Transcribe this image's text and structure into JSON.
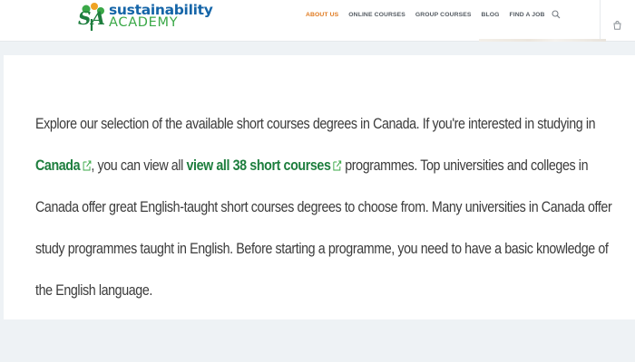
{
  "header": {
    "logo": {
      "mark_text": "SA",
      "line1": "sustainability",
      "line2": "ACADEMY"
    },
    "nav": [
      {
        "label": "ABOUT US",
        "active": true
      },
      {
        "label": "ONLINE COURSES",
        "active": false
      },
      {
        "label": "GROUP COURSES",
        "active": false
      },
      {
        "label": "BLOG",
        "active": false
      },
      {
        "label": "FIND A JOB",
        "active": false
      }
    ],
    "icons": {
      "search": "search-icon",
      "cart": "cart-icon"
    }
  },
  "content": {
    "paragraph": {
      "part1": "Explore our selection of the available short courses degrees in Canada. If you're interested in studying in ",
      "link1": "Canada",
      "part2": ", you can view all ",
      "link2": "view all 38 short courses",
      "part3": " programmes. Top universities and colleges in Canada offer great English-taught short courses degrees to choose from. Many universities in Canada offer study programmes taught in English. Before starting a programme, you need to have a basic knowledge of the English language."
    }
  },
  "colors": {
    "accent_orange": "#e07a1f",
    "brand_blue": "#1565a8",
    "brand_green": "#3aa847",
    "link_green": "#1e7e3e",
    "page_bg": "#eef2f5"
  }
}
